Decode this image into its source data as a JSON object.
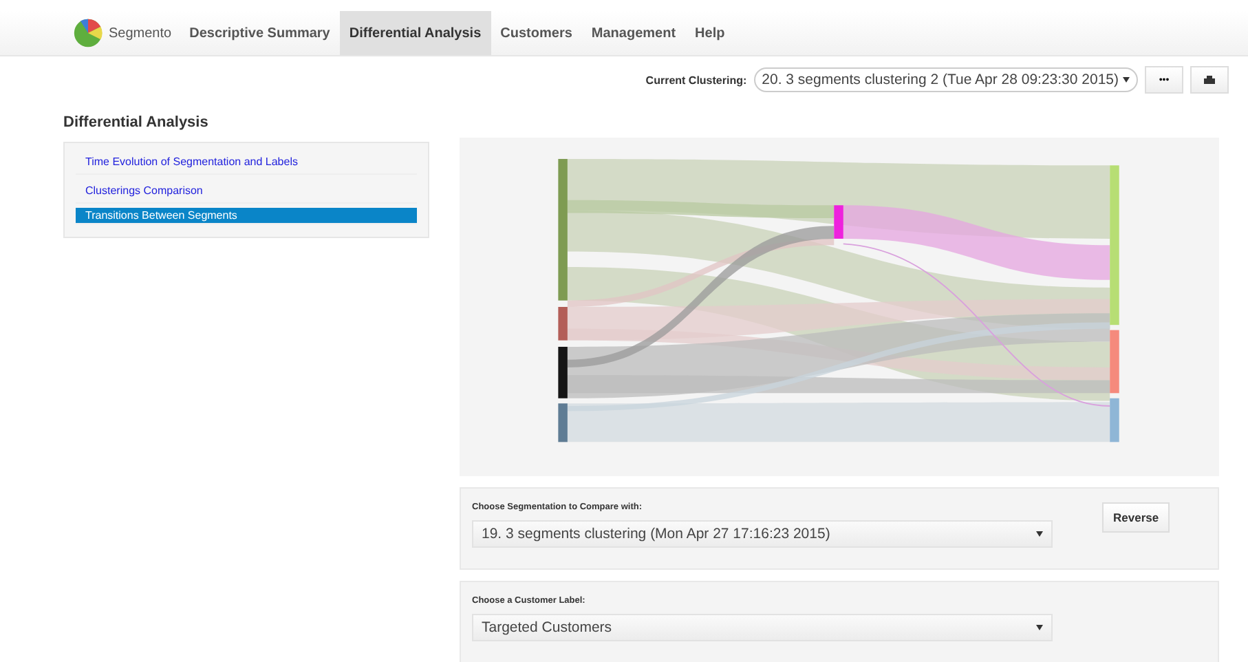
{
  "navbar": {
    "brand": "Segmento",
    "items": [
      {
        "label": "Descriptive Summary",
        "selected": false
      },
      {
        "label": "Differential Analysis",
        "selected": true
      },
      {
        "label": "Customers",
        "selected": false
      },
      {
        "label": "Management",
        "selected": false
      },
      {
        "label": "Help",
        "selected": false
      }
    ]
  },
  "clustering": {
    "label": "Current Clustering:",
    "value": "20. 3 segments clustering 2 (Tue Apr 28 09:23:30 2015)",
    "more_button": "•••"
  },
  "sidebar": {
    "title": "Differential Analysis",
    "items": [
      {
        "label": "Time Evolution of Segmentation and Labels",
        "selected": false
      },
      {
        "label": "Clusterings Comparison",
        "selected": false
      },
      {
        "label": "Transitions Between Segments",
        "selected": true
      }
    ]
  },
  "compare": {
    "label": "Choose Segmentation to Compare with:",
    "value": "19. 3 segments clustering (Mon Apr 27 17:16:23 2015)",
    "button": "Reverse"
  },
  "customer_label": {
    "label": "Choose a Customer Label:",
    "value": "Targeted Customers"
  }
}
